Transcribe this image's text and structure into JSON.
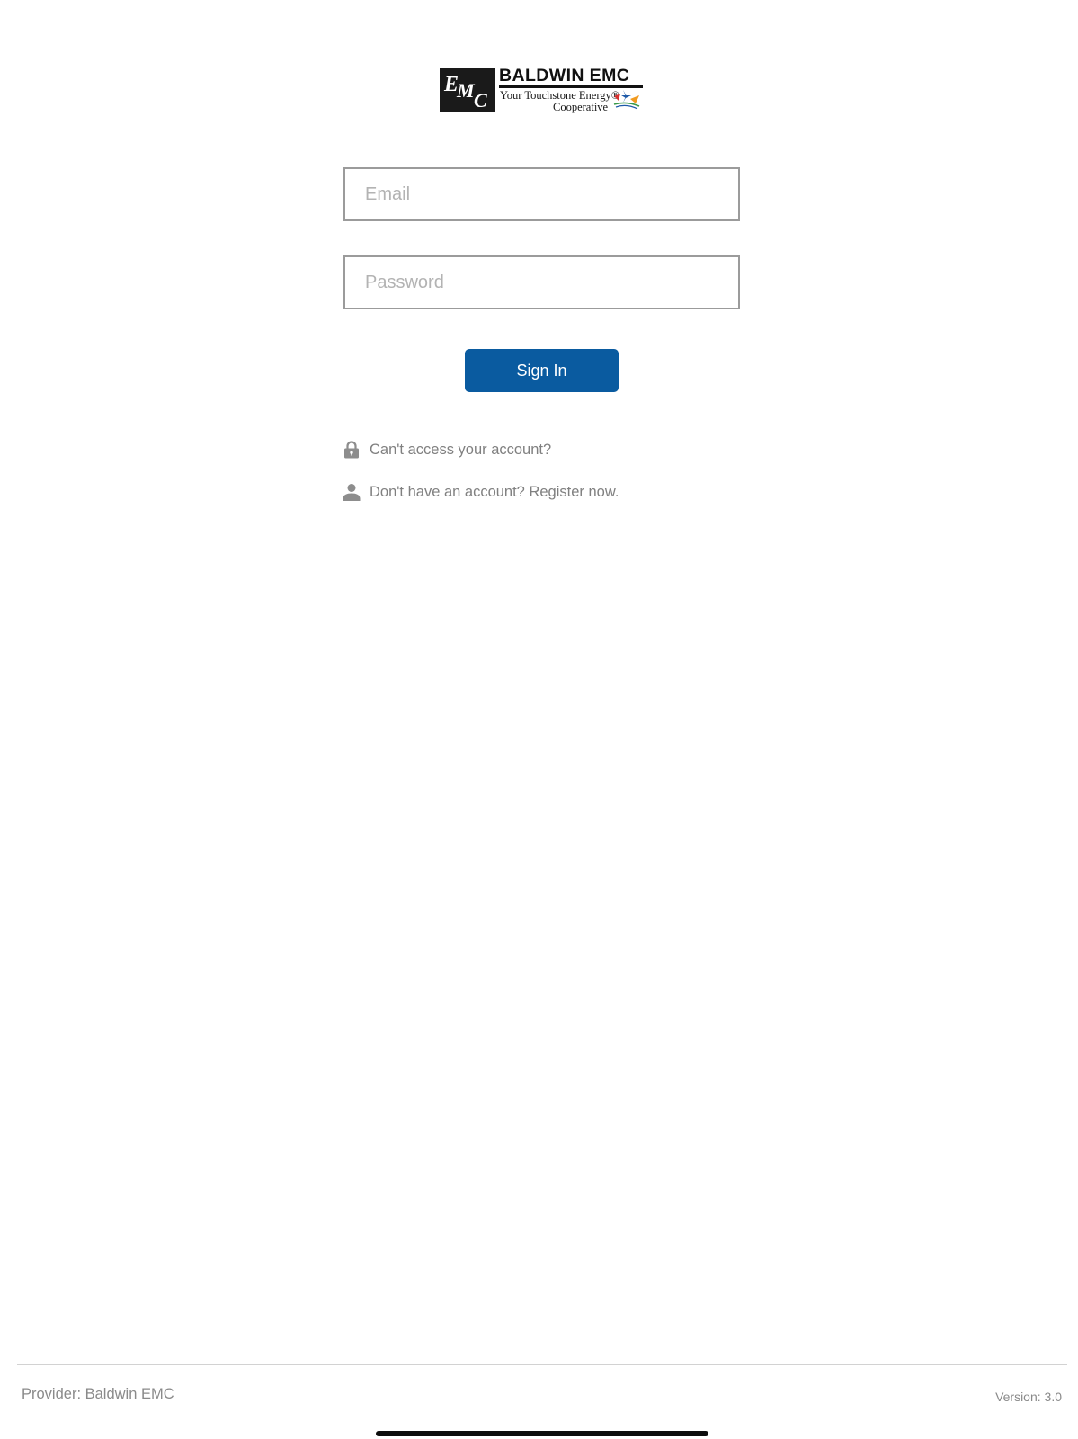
{
  "logo": {
    "mark_text": "EMC",
    "name": "BALDWIN EMC",
    "tagline_line1": "Your Touchstone Energy®",
    "tagline_line2": "Cooperative",
    "colors": {
      "mark_bg": "#1a1a1a",
      "star_red": "#d8302f",
      "star_blue": "#1e5aa8",
      "star_orange": "#f19a1f",
      "star_green": "#3a9a4a"
    }
  },
  "login_form": {
    "email_placeholder": "Email",
    "password_placeholder": "Password",
    "email_value": "",
    "password_value": "",
    "sign_in_label": "Sign In"
  },
  "links": {
    "cant_access": {
      "icon": "lock-icon",
      "label": "Can't access your account?"
    },
    "register": {
      "icon": "person-icon",
      "label": "Don't have an account? Register now."
    }
  },
  "footer": {
    "provider": "Provider: Baldwin EMC",
    "version": "Version: 3.0"
  },
  "theme": {
    "primary": "#0a5ba0",
    "border": "#9b9b9b",
    "muted_text": "#808080",
    "divider": "#d2d2d2"
  }
}
